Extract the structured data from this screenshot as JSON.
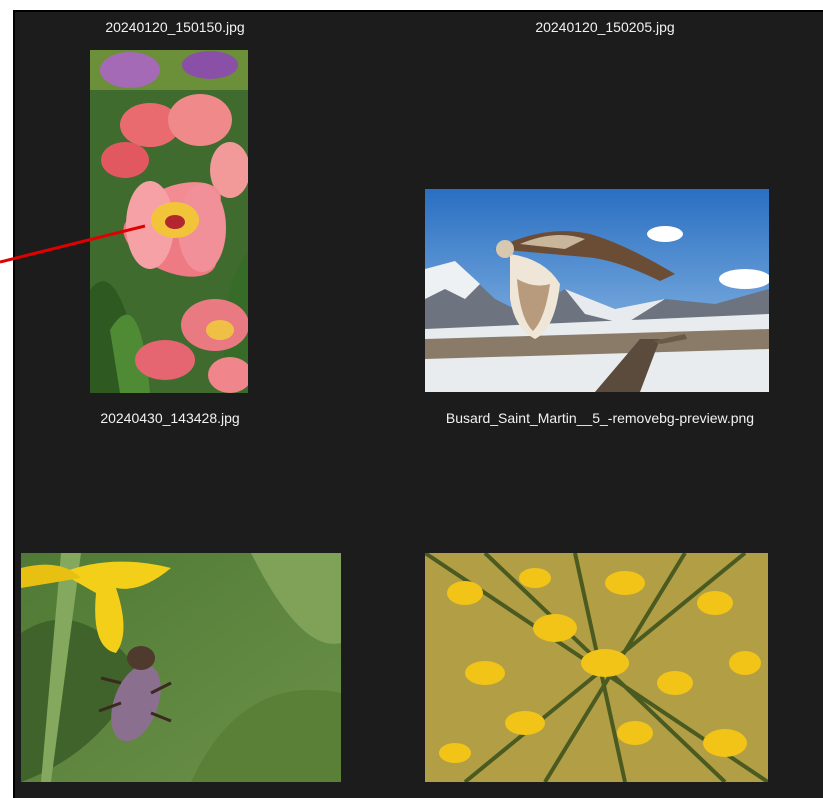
{
  "files": [
    {
      "name": "20240120_150150.jpg"
    },
    {
      "name": "20240120_150205.jpg"
    },
    {
      "name": "20240430_143428.jpg"
    },
    {
      "name": "Busard_Saint_Martin__5_-removebg-preview.png"
    }
  ],
  "colors": {
    "pane_bg": "#1c1c1c",
    "label_text": "#f2f2f2",
    "arrow": "#e00000"
  },
  "icons": {
    "annotation": "red-arrow-icon"
  }
}
